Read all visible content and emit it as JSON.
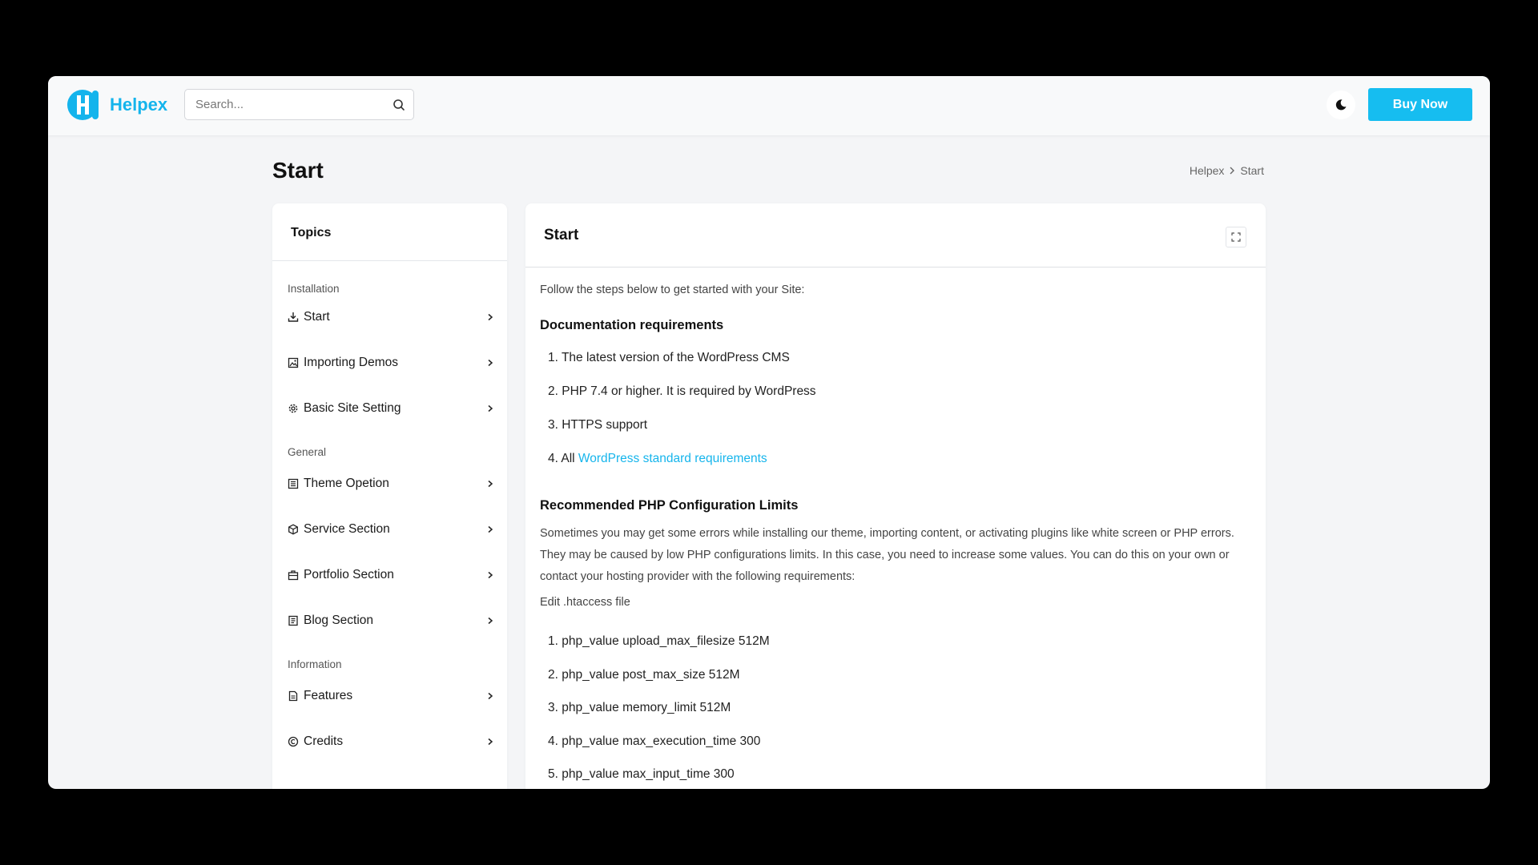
{
  "brand": {
    "name": "Helpex",
    "accent": "#16bdf0"
  },
  "header": {
    "search_placeholder": "Search...",
    "search_icon": "search-icon",
    "theme_icon": "moon-icon",
    "buy_label": "Buy Now"
  },
  "page": {
    "title": "Start",
    "breadcrumb": [
      "Helpex",
      "Start"
    ]
  },
  "sidebar": {
    "title": "Topics",
    "groups": [
      {
        "label": "Installation",
        "items": [
          {
            "label": "Start",
            "icon": "download-icon"
          },
          {
            "label": "Importing Demos",
            "icon": "image-icon"
          },
          {
            "label": "Basic Site Setting",
            "icon": "gear-icon"
          }
        ]
      },
      {
        "label": "General",
        "items": [
          {
            "label": "Theme Opetion",
            "icon": "layout-icon"
          },
          {
            "label": "Service Section",
            "icon": "box-icon"
          },
          {
            "label": "Portfolio Section",
            "icon": "briefcase-icon"
          },
          {
            "label": "Blog Section",
            "icon": "document-icon"
          }
        ]
      },
      {
        "label": "Information",
        "items": [
          {
            "label": "Features",
            "icon": "file-icon"
          },
          {
            "label": "Credits",
            "icon": "copyright-icon"
          }
        ]
      }
    ]
  },
  "content": {
    "title": "Start",
    "intro": "Follow the steps below to get started with your Site:",
    "req_heading": "Documentation requirements",
    "requirements": [
      "1. The latest version of the WordPress CMS",
      "2. PHP 7.4 or higher. It is required by WordPress",
      "3. HTTPS support"
    ],
    "req4_prefix": "4. All ",
    "req4_link": "WordPress standard requirements",
    "php_heading": "Recommended PHP Configuration Limits",
    "php_text": "Sometimes you may get some errors while installing our theme, importing content, or activating plugins like white screen or PHP errors. They may be caused by low PHP configurations limits. In this case, you need to increase some values. You can do this on your own or contact your hosting provider with the following requirements:",
    "htaccess": "Edit .htaccess file",
    "php_values": [
      "1. php_value upload_max_filesize 512M",
      "2. php_value post_max_size 512M",
      "3. php_value memory_limit 512M",
      "4. php_value max_execution_time 300",
      "5. php_value max_input_time 300"
    ]
  }
}
